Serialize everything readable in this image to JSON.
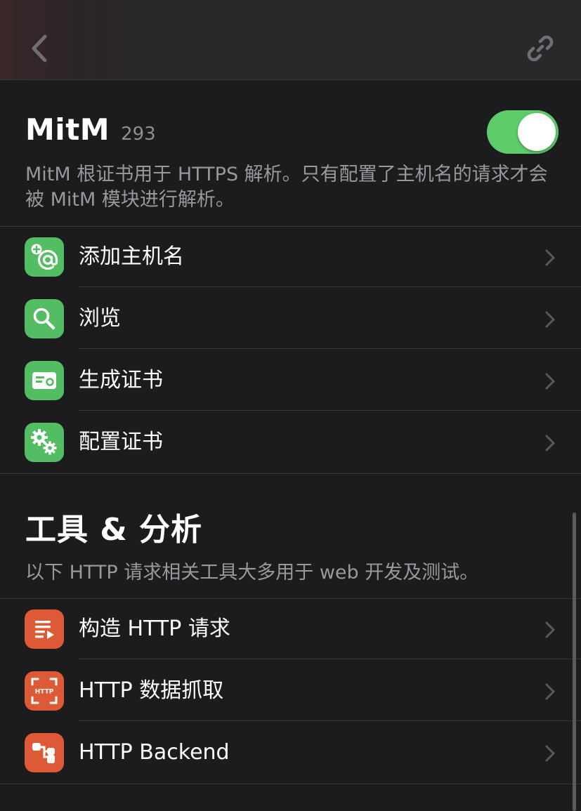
{
  "nav": {
    "back_icon": "chevron-left-icon",
    "link_icon": "link-icon"
  },
  "mitm": {
    "title": "MitM",
    "count": "293",
    "enabled": true,
    "description": "MitM 根证书用于 HTTPS 解析。只有配置了主机名的请求才会被 MitM 模块进行解析。",
    "items": [
      {
        "label": "添加主机名",
        "icon": "add-hostname-at-icon"
      },
      {
        "label": "浏览",
        "icon": "search-icon"
      },
      {
        "label": "生成证书",
        "icon": "certificate-icon"
      },
      {
        "label": "配置证书",
        "icon": "gears-icon"
      }
    ]
  },
  "tools": {
    "title": "工具 & 分析",
    "description": "以下 HTTP 请求相关工具大多用于 web 开发及测试。",
    "items": [
      {
        "label": "构造 HTTP 请求",
        "icon": "compose-request-icon"
      },
      {
        "label": "HTTP 数据抓取",
        "icon": "http-capture-icon",
        "icon_text": "HTTP"
      },
      {
        "label": "HTTP Backend",
        "icon": "backend-tree-icon"
      }
    ]
  },
  "colors": {
    "background": "#1c1c1e",
    "toggle_on": "#5fcc6c",
    "green_icon": "#52bd62",
    "orange_icon": "#dd5a36",
    "secondary_text": "#98989d"
  }
}
